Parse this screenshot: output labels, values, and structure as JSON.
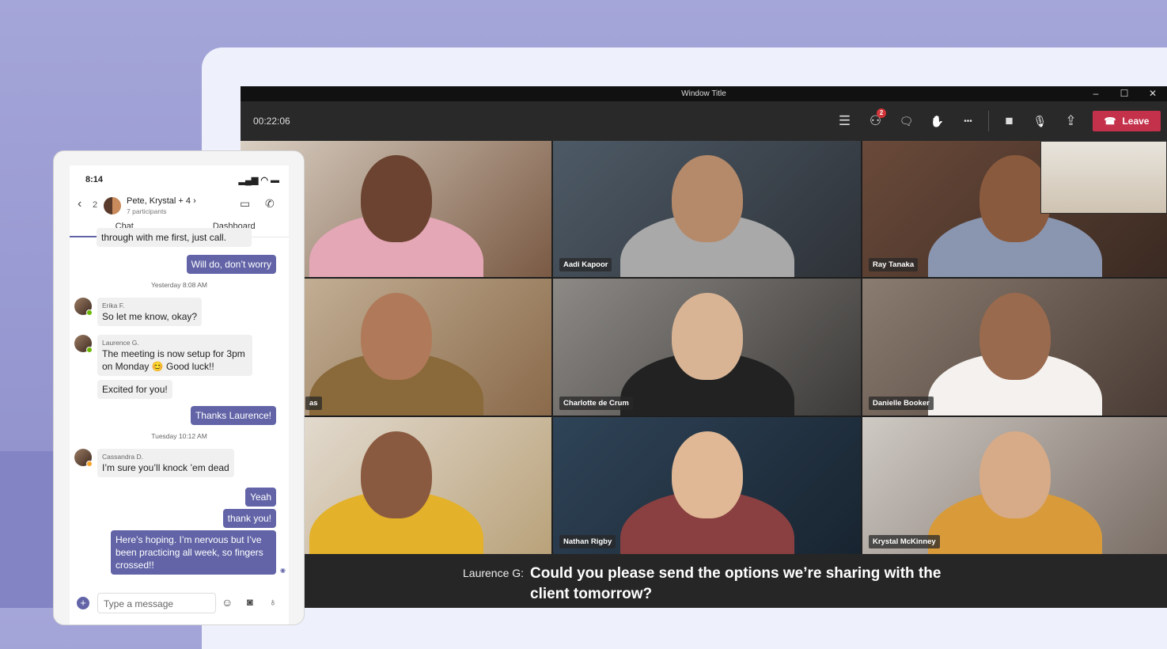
{
  "window": {
    "title": "Window Title",
    "minimize": "–",
    "maximize": "☐",
    "close": "✕"
  },
  "meeting": {
    "timer": "00:22:06",
    "participants_badge": "2",
    "leave_label": "Leave",
    "toolbar": [
      {
        "icon": "list-icon",
        "glyph": "☰"
      },
      {
        "icon": "participants-icon",
        "glyph": "⚇"
      },
      {
        "icon": "chat-icon",
        "glyph": "🗨"
      },
      {
        "icon": "raise-hand-icon",
        "glyph": "✋"
      },
      {
        "icon": "more-icon",
        "glyph": "•••"
      },
      {
        "icon": "camera-icon",
        "glyph": "■"
      },
      {
        "icon": "mic-icon",
        "glyph": "🎙"
      },
      {
        "icon": "share-screen-icon",
        "glyph": "⇪"
      }
    ]
  },
  "tiles": [
    {
      "name": ""
    },
    {
      "name": "Aadi Kapoor"
    },
    {
      "name": "Ray Tanaka"
    },
    {
      "name": "as"
    },
    {
      "name": "Charlotte de Crum"
    },
    {
      "name": "Danielle Booker"
    },
    {
      "name": ""
    },
    {
      "name": "Nathan Rigby"
    },
    {
      "name": "Krystal McKinney"
    }
  ],
  "caption": {
    "speaker": "Laurence G:",
    "text": "Could you please send the options we’re sharing with the client tomorrow?"
  },
  "phone": {
    "time": "8:14",
    "back_count": "2",
    "chat_title": "Pete, Krystal + 4 ›",
    "chat_subtitle": "7 participants",
    "tabs": [
      "Chat",
      "Dashboard"
    ],
    "messages": {
      "m0": "through with me first, just call.",
      "m1": "Will do, don’t worry",
      "t1": "Yesterday 8:08 AM",
      "s2": "Erika F.",
      "m2": "So let me know, okay?",
      "s3": "Laurence G.",
      "m3": "The meeting is now setup for 3pm on Monday 😊 Good luck!!",
      "m4": "Excited for you!",
      "m5": "Thanks Laurence!",
      "t2": "Tuesday 10:12 AM",
      "s6": "Cassandra D.",
      "m6": "I’m sure you’ll knock ’em dead",
      "m7": "Yeah",
      "m8": "thank you!",
      "m9": "Here’s hoping. I’m nervous but I’ve been practicing all week, so fingers crossed!!"
    },
    "compose_placeholder": "Type a message"
  },
  "colors": {
    "accent": "#6264a7",
    "leave": "#c4314b",
    "badge": "#d13438"
  }
}
